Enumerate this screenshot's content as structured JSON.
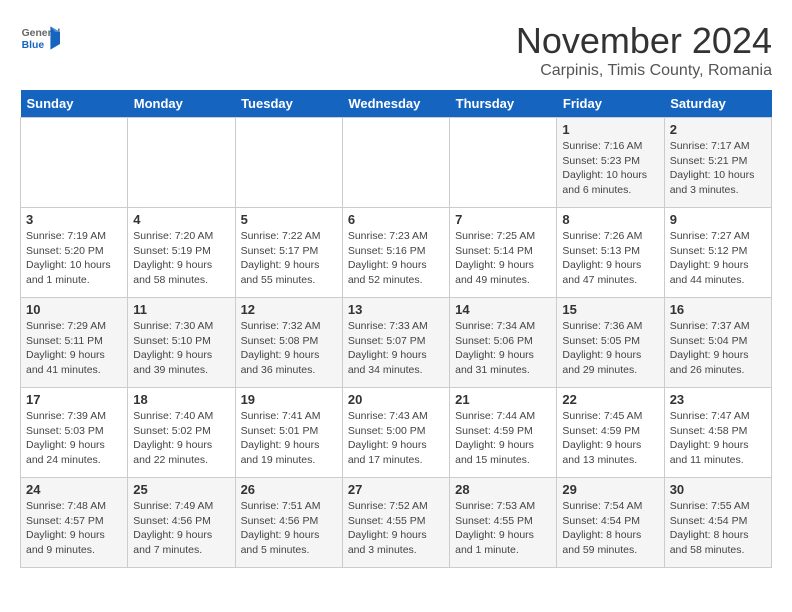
{
  "header": {
    "logo_general": "General",
    "logo_blue": "Blue",
    "month_title": "November 2024",
    "subtitle": "Carpinis, Timis County, Romania"
  },
  "days_of_week": [
    "Sunday",
    "Monday",
    "Tuesday",
    "Wednesday",
    "Thursday",
    "Friday",
    "Saturday"
  ],
  "weeks": [
    [
      {
        "day": "",
        "info": ""
      },
      {
        "day": "",
        "info": ""
      },
      {
        "day": "",
        "info": ""
      },
      {
        "day": "",
        "info": ""
      },
      {
        "day": "",
        "info": ""
      },
      {
        "day": "1",
        "info": "Sunrise: 7:16 AM\nSunset: 5:23 PM\nDaylight: 10 hours and 6 minutes."
      },
      {
        "day": "2",
        "info": "Sunrise: 7:17 AM\nSunset: 5:21 PM\nDaylight: 10 hours and 3 minutes."
      }
    ],
    [
      {
        "day": "3",
        "info": "Sunrise: 7:19 AM\nSunset: 5:20 PM\nDaylight: 10 hours and 1 minute."
      },
      {
        "day": "4",
        "info": "Sunrise: 7:20 AM\nSunset: 5:19 PM\nDaylight: 9 hours and 58 minutes."
      },
      {
        "day": "5",
        "info": "Sunrise: 7:22 AM\nSunset: 5:17 PM\nDaylight: 9 hours and 55 minutes."
      },
      {
        "day": "6",
        "info": "Sunrise: 7:23 AM\nSunset: 5:16 PM\nDaylight: 9 hours and 52 minutes."
      },
      {
        "day": "7",
        "info": "Sunrise: 7:25 AM\nSunset: 5:14 PM\nDaylight: 9 hours and 49 minutes."
      },
      {
        "day": "8",
        "info": "Sunrise: 7:26 AM\nSunset: 5:13 PM\nDaylight: 9 hours and 47 minutes."
      },
      {
        "day": "9",
        "info": "Sunrise: 7:27 AM\nSunset: 5:12 PM\nDaylight: 9 hours and 44 minutes."
      }
    ],
    [
      {
        "day": "10",
        "info": "Sunrise: 7:29 AM\nSunset: 5:11 PM\nDaylight: 9 hours and 41 minutes."
      },
      {
        "day": "11",
        "info": "Sunrise: 7:30 AM\nSunset: 5:10 PM\nDaylight: 9 hours and 39 minutes."
      },
      {
        "day": "12",
        "info": "Sunrise: 7:32 AM\nSunset: 5:08 PM\nDaylight: 9 hours and 36 minutes."
      },
      {
        "day": "13",
        "info": "Sunrise: 7:33 AM\nSunset: 5:07 PM\nDaylight: 9 hours and 34 minutes."
      },
      {
        "day": "14",
        "info": "Sunrise: 7:34 AM\nSunset: 5:06 PM\nDaylight: 9 hours and 31 minutes."
      },
      {
        "day": "15",
        "info": "Sunrise: 7:36 AM\nSunset: 5:05 PM\nDaylight: 9 hours and 29 minutes."
      },
      {
        "day": "16",
        "info": "Sunrise: 7:37 AM\nSunset: 5:04 PM\nDaylight: 9 hours and 26 minutes."
      }
    ],
    [
      {
        "day": "17",
        "info": "Sunrise: 7:39 AM\nSunset: 5:03 PM\nDaylight: 9 hours and 24 minutes."
      },
      {
        "day": "18",
        "info": "Sunrise: 7:40 AM\nSunset: 5:02 PM\nDaylight: 9 hours and 22 minutes."
      },
      {
        "day": "19",
        "info": "Sunrise: 7:41 AM\nSunset: 5:01 PM\nDaylight: 9 hours and 19 minutes."
      },
      {
        "day": "20",
        "info": "Sunrise: 7:43 AM\nSunset: 5:00 PM\nDaylight: 9 hours and 17 minutes."
      },
      {
        "day": "21",
        "info": "Sunrise: 7:44 AM\nSunset: 4:59 PM\nDaylight: 9 hours and 15 minutes."
      },
      {
        "day": "22",
        "info": "Sunrise: 7:45 AM\nSunset: 4:59 PM\nDaylight: 9 hours and 13 minutes."
      },
      {
        "day": "23",
        "info": "Sunrise: 7:47 AM\nSunset: 4:58 PM\nDaylight: 9 hours and 11 minutes."
      }
    ],
    [
      {
        "day": "24",
        "info": "Sunrise: 7:48 AM\nSunset: 4:57 PM\nDaylight: 9 hours and 9 minutes."
      },
      {
        "day": "25",
        "info": "Sunrise: 7:49 AM\nSunset: 4:56 PM\nDaylight: 9 hours and 7 minutes."
      },
      {
        "day": "26",
        "info": "Sunrise: 7:51 AM\nSunset: 4:56 PM\nDaylight: 9 hours and 5 minutes."
      },
      {
        "day": "27",
        "info": "Sunrise: 7:52 AM\nSunset: 4:55 PM\nDaylight: 9 hours and 3 minutes."
      },
      {
        "day": "28",
        "info": "Sunrise: 7:53 AM\nSunset: 4:55 PM\nDaylight: 9 hours and 1 minute."
      },
      {
        "day": "29",
        "info": "Sunrise: 7:54 AM\nSunset: 4:54 PM\nDaylight: 8 hours and 59 minutes."
      },
      {
        "day": "30",
        "info": "Sunrise: 7:55 AM\nSunset: 4:54 PM\nDaylight: 8 hours and 58 minutes."
      }
    ]
  ]
}
